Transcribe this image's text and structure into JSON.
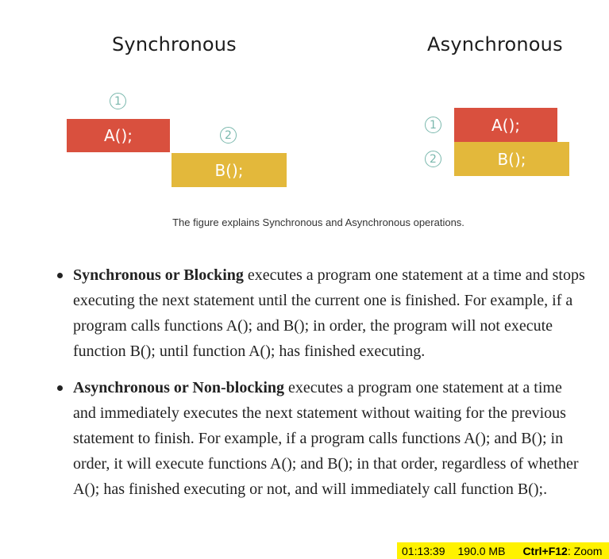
{
  "figure": {
    "sync_title": "Synchronous",
    "async_title": "Asynchronous",
    "sync_blocks": [
      {
        "num": "1",
        "label": "A();",
        "color": "#d9503e"
      },
      {
        "num": "2",
        "label": "B();",
        "color": "#e3b83b"
      }
    ],
    "async_blocks": [
      {
        "num": "1",
        "label": "A();",
        "color": "#d9503e"
      },
      {
        "num": "2",
        "label": "B();",
        "color": "#e3b83b"
      }
    ],
    "caption": "The figure explains Synchronous and Asynchronous operations."
  },
  "bullets": [
    {
      "bold": "Synchronous or Blocking",
      "text": " executes a program one statement at a time and stops executing the next statement until the current one is finished. For example, if a program calls functions A(); and B(); in order, the program will not execute function B(); until function A(); has finished executing."
    },
    {
      "bold": "Asynchronous or Non-blocking",
      "text": " executes a program one statement at a time and immediately executes the next statement without waiting for the previous statement to finish. For example, if a program calls functions A(); and B(); in order, it will execute functions A(); and B(); in that order, regardless of whether A(); has finished executing or not, and will immediately call function B();."
    }
  ],
  "status_bar": {
    "time": "01:13:39",
    "memory": "190.0 MB",
    "shortcut": "Ctrl+F12",
    "action": ": Zoom"
  }
}
